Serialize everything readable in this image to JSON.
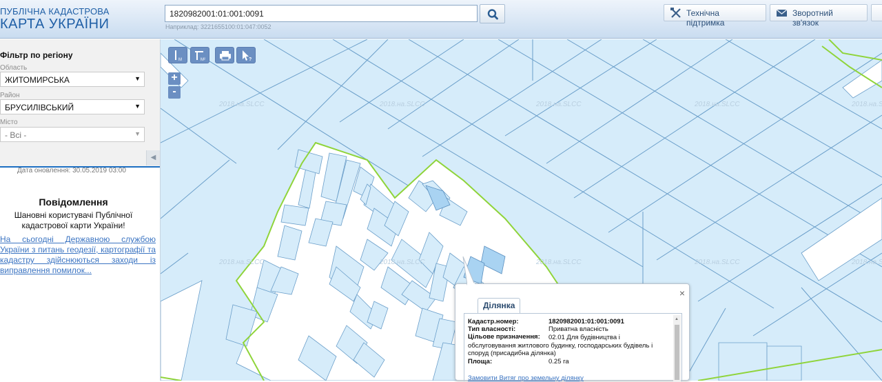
{
  "header": {
    "logo_line1": "ПУБЛІЧНА КАДАСТРОВА",
    "logo_line2": "КАРТА УКРАЇНИ",
    "search_value": "1820982001:01:001:0091",
    "search_hint": "Наприклад: 3221655100:01:047:0052",
    "support_label": "Технічна підтримка",
    "feedback_label": "Зворотний зв'язок"
  },
  "sidebar": {
    "filter_title": "Фільтр по регіону",
    "region_label": "Область",
    "region_value": "ЖИТОМИРСЬКА",
    "district_label": "Район",
    "district_value": "БРУСИЛІВСЬКИЙ",
    "city_label": "Місто",
    "city_value": "- Всі -",
    "update_date": "Дата оновлення: 30.05.2019 03:00",
    "notice_title": "Повідомлення",
    "notice_text": "Шановні користувачі Публічної кадастрової карти України!",
    "notice_link": "На сьогодні Державною службою України з питань геодезії, картографії та кадастру здійснюються заходи із виправлення помилок..."
  },
  "map": {
    "watermark": "2018.на.SLCC",
    "zoom_in": "+",
    "zoom_out": "-",
    "colors": {
      "parcel_fill": "#d6ecfa",
      "parcel_stroke": "#6a9ec9",
      "boundary": "#8fd43a",
      "road": "#ffffff",
      "selected": "#a9d3f2"
    }
  },
  "popup": {
    "tab": "Ділянка",
    "cadastral_label": "Кадастр.номер:",
    "cadastral_value": "1820982001:01:001:0091",
    "ownership_label": "Тип власності:",
    "ownership_value": "Приватна власність",
    "purpose_label": "Цільове призначення:",
    "purpose_value": "02.01 Для будівництва і обслуговування житлового будинку, господарських будівель і споруд (присадибна ділянка)",
    "area_label": "Площа:",
    "area_value": "0.25 га",
    "extract_link": "Замовити Витяг про земельну ділянку",
    "close": "×"
  }
}
